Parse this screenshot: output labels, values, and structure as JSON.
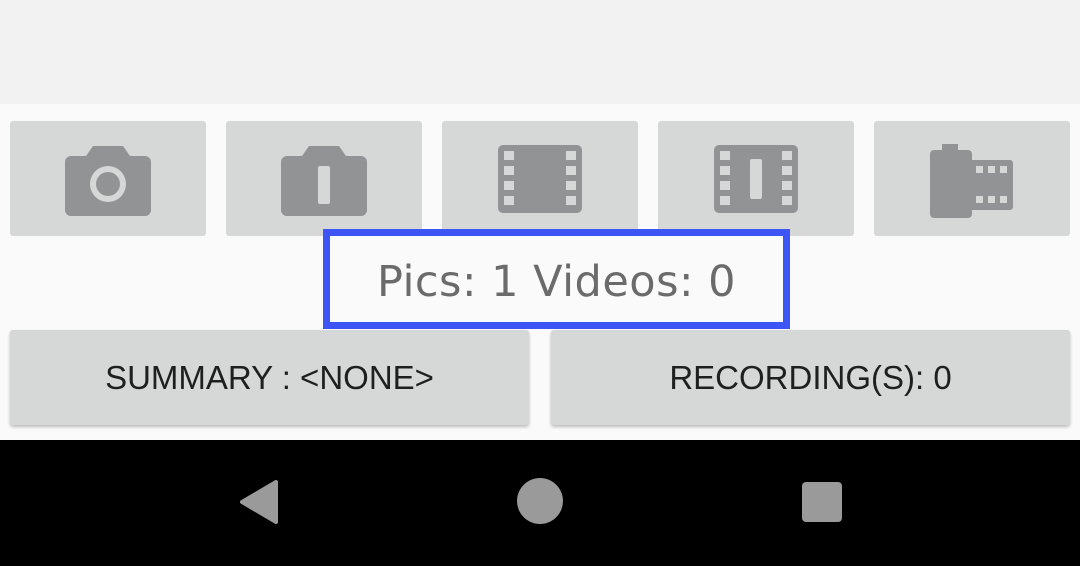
{
  "media_buttons": [
    {
      "icon": "camera-icon"
    },
    {
      "icon": "camera-pause-icon"
    },
    {
      "icon": "film-icon"
    },
    {
      "icon": "film-pause-icon"
    },
    {
      "icon": "film-roll-icon"
    }
  ],
  "counter": {
    "text": "Pics: 1 Videos: 0",
    "highlight_color": "#3d55f5"
  },
  "actions": {
    "summary_label": "SUMMARY : <NONE>",
    "recordings_label": "RECORDING(S): 0"
  },
  "navigation": {
    "back_icon": "back-icon",
    "home_icon": "home-icon",
    "recents_icon": "recents-icon"
  },
  "colors": {
    "icon_gray": "#929394",
    "button_bg": "#d6d7d7",
    "nav_bg": "#000000",
    "nav_icon": "#9a9a9a"
  }
}
